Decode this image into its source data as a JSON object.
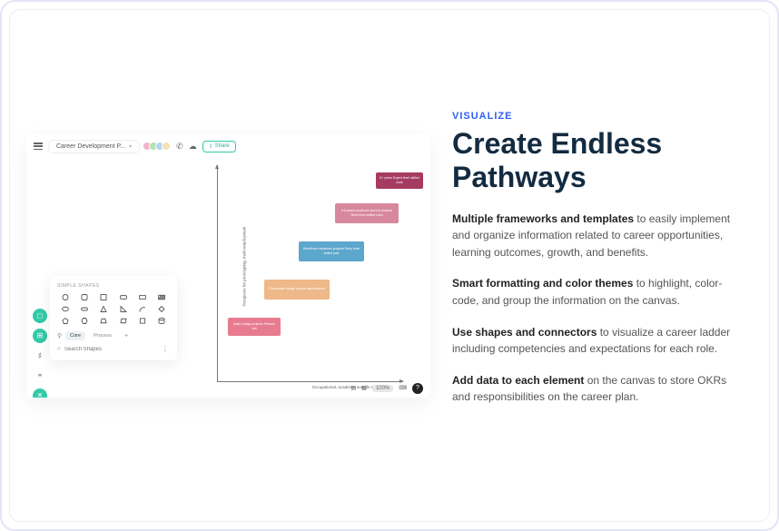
{
  "eyebrow": "VISUALIZE",
  "headline": "Create Endless Pathways",
  "bullets": [
    {
      "bold": "Multiple frameworks and templates",
      "rest": " to easily implement and organize information related to career opportunities, learning outcomes, growth, and benefits."
    },
    {
      "bold": "Smart formatting and color themes",
      "rest": " to highlight, color-code, and group the information on the canvas."
    },
    {
      "bold": "Use shapes and connectors",
      "rest": " to visualize a career ladder including competencies and expectations for each role."
    },
    {
      "bold": "Add data to each element",
      "rest": " on the canvas to store OKRs and responsibilities on the career plan."
    }
  ],
  "app": {
    "title": "Career Development P...",
    "share": "Share",
    "ylabel": "Prospects for prototyping, multi-employment",
    "xlabel": "Occupational, academic and life skills",
    "zoom": "100%",
    "cards": {
      "c1": "6+ years\nExpert level skilled work",
      "c2": "3-5 years workforce and full\nprojects\nWork level skilled roles",
      "c3": "Workforce readiness projects\nEntry level skilled jobs",
      "c4": "Preparation bridge support\nassociations",
      "c5": "Basic bridge projects\nPrimary info"
    },
    "shapes": {
      "header": "SIMPLE SHAPES",
      "tab_core": "Core",
      "tab_process": "Process",
      "search_placeholder": "Search Shapes"
    }
  }
}
